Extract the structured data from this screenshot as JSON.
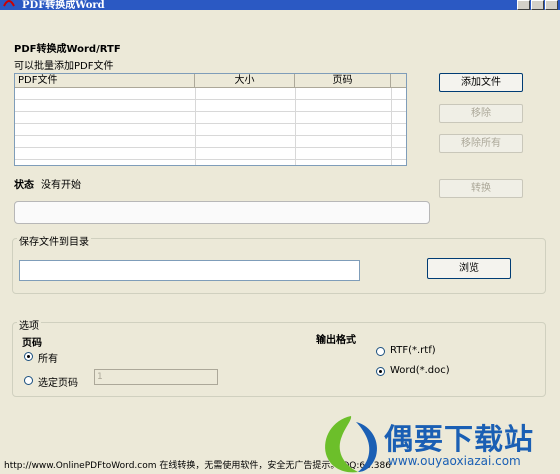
{
  "window": {
    "title": "PDF转换成Word"
  },
  "main": {
    "heading": "PDF转换成Word/RTF",
    "subheading": "可以批量添加PDF文件",
    "file_list": {
      "columns": [
        "PDF文件",
        "大小",
        "页码"
      ]
    },
    "buttons": {
      "add_file": "添加文件",
      "remove": "移除",
      "remove_all": "移除所有",
      "convert": "转换",
      "browse": "浏览"
    },
    "status": {
      "label": "状态",
      "value": "没有开始"
    },
    "save_group": {
      "legend": "保存文件到目录",
      "path_value": ""
    },
    "options_group": {
      "legend": "选项",
      "pages": {
        "label": "页码",
        "all_label": "所有",
        "selected_label": "选定页码",
        "selected_value": "1",
        "selected_option": "all"
      },
      "format": {
        "label": "输出格式",
        "rtf_label": "RTF(*.rtf)",
        "doc_label": "Word(*.doc)",
        "selected_option": "doc"
      }
    }
  },
  "footer": {
    "text": "http://www.OnlinePDFtoWord.com  在线转换，无需使用软件，安全无广告提示。 QQ:68.386"
  },
  "watermark": {
    "brand": "偶要下载站",
    "url": "www.ouyaoxiazai.com"
  },
  "colors": {
    "titlebar": "#2b59c3",
    "button_border": "#003c74",
    "brand_blue": "#1a5fb4",
    "logo_green": "#6cbf2a"
  }
}
